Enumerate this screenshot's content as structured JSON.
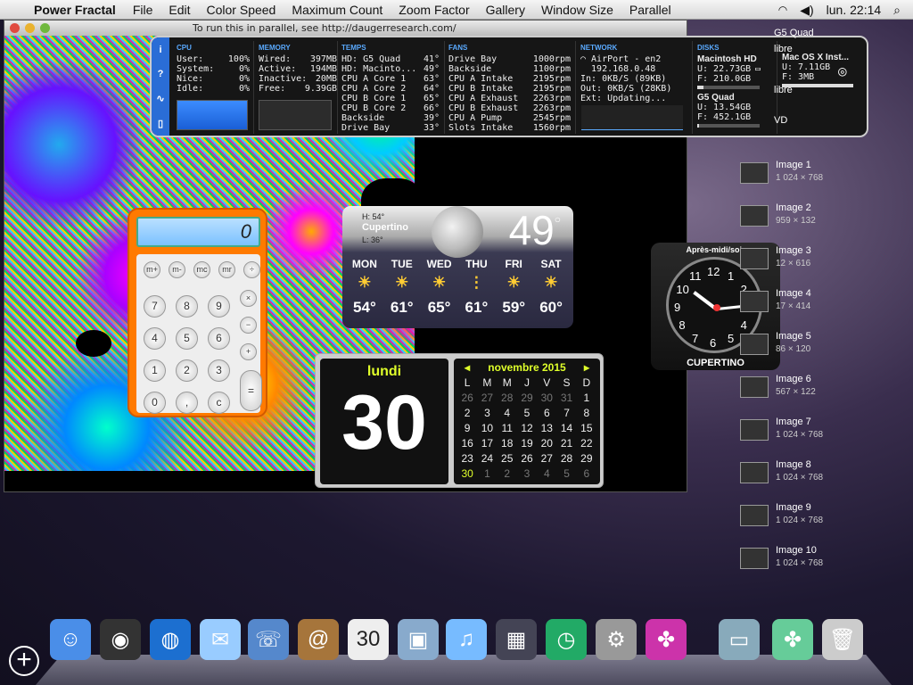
{
  "menubar": {
    "app": "Power Fractal",
    "items": [
      "File",
      "Edit",
      "Color Speed",
      "Maximum Count",
      "Zoom Factor",
      "Gallery",
      "Window Size",
      "Parallel"
    ],
    "clock": "lun. 22:14"
  },
  "window": {
    "title": "To run this in parallel, see http://daugerresearch.com/"
  },
  "istat": {
    "cpu": {
      "h": "CPU",
      "rows": [
        [
          "User:",
          "100%"
        ],
        [
          "System:",
          "0%"
        ],
        [
          "Nice:",
          "0%"
        ],
        [
          "Idle:",
          "0%"
        ]
      ]
    },
    "memory": {
      "h": "MEMORY",
      "rows": [
        [
          "Wired:",
          "397MB"
        ],
        [
          "Active:",
          "194MB"
        ],
        [
          "Inactive:",
          "20MB"
        ],
        [
          "Free:",
          "9.39GB"
        ]
      ]
    },
    "temps": {
      "h": "TEMPS",
      "rows": [
        [
          "HD: G5 Quad",
          "41°"
        ],
        [
          "HD: Macinto...",
          "49°"
        ],
        [
          "CPU A Core 1",
          "63°"
        ],
        [
          "CPU A Core 2",
          "64°"
        ],
        [
          "CPU B Core 1",
          "65°"
        ],
        [
          "CPU B Core 2",
          "66°"
        ],
        [
          "Backside",
          "39°"
        ],
        [
          "Drive Bay",
          "33°"
        ]
      ]
    },
    "fans": {
      "h": "FANS",
      "rows": [
        [
          "Drive Bay",
          "1000rpm"
        ],
        [
          "Backside",
          "1100rpm"
        ],
        [
          "CPU A Intake",
          "2195rpm"
        ],
        [
          "CPU B Intake",
          "2195rpm"
        ],
        [
          "CPU A Exhaust",
          "2263rpm"
        ],
        [
          "CPU B Exhaust",
          "2263rpm"
        ],
        [
          "CPU A Pump",
          "2545rpm"
        ],
        [
          "Slots Intake",
          "1560rpm"
        ]
      ]
    },
    "network": {
      "h": "NETWORK",
      "iface": "AirPort - en2",
      "ip": "192.168.0.48",
      "in": "In: 0KB/S (89KB)",
      "out": "Out: 0KB/S (28KB)",
      "ext": "Ext: Updating..."
    },
    "disks": {
      "h": "DISKS",
      "d1": "Macintosh HD",
      "d1u": "U: 22.73GB",
      "d1f": "F: 210.0GB",
      "d1p": 0.1,
      "d2": "G5 Quad",
      "d2u": "U: 13.54GB",
      "d2f": "F: 452.1GB",
      "d2p": 0.03,
      "d3": "Mac OS X Inst...",
      "d3u": "U: 7.11GB",
      "d3f": "F: 3MB",
      "d3p": 1.0
    }
  },
  "calculator": {
    "display": "0",
    "keys": [
      "m+",
      "m-",
      "mc",
      "mr",
      "÷",
      "7",
      "8",
      "9",
      "×",
      "4",
      "5",
      "6",
      "−",
      "1",
      "2",
      "3",
      "+",
      "0",
      ",",
      "c",
      "="
    ]
  },
  "weather": {
    "high": "H: 54°",
    "low": "L: 36°",
    "city": "Cupertino",
    "temp": "49",
    "forecast": [
      {
        "d": "MON",
        "t": "54°"
      },
      {
        "d": "TUE",
        "t": "61°"
      },
      {
        "d": "WED",
        "t": "65°"
      },
      {
        "d": "THU",
        "t": "61°"
      },
      {
        "d": "FRI",
        "t": "59°"
      },
      {
        "d": "SAT",
        "t": "60°"
      }
    ]
  },
  "clock": {
    "label": "Après-midi/soir",
    "city": "CUPERTINO",
    "hour": 10,
    "minute": 14
  },
  "calendar": {
    "day_name": "lundi",
    "day": "30",
    "month": "novembre 2015",
    "headers": [
      "L",
      "M",
      "M",
      "J",
      "V",
      "S",
      "D"
    ],
    "days": [
      "26",
      "27",
      "28",
      "29",
      "30",
      "31",
      "1",
      "2",
      "3",
      "4",
      "5",
      "6",
      "7",
      "8",
      "9",
      "10",
      "11",
      "12",
      "13",
      "14",
      "15",
      "16",
      "17",
      "18",
      "19",
      "20",
      "21",
      "22",
      "23",
      "24",
      "25",
      "26",
      "27",
      "28",
      "29",
      "30",
      "1",
      "2",
      "3",
      "4",
      "5",
      "6"
    ]
  },
  "files": [
    {
      "n": "G5 Quad"
    },
    {
      "n": "libre"
    },
    {
      "n": "libre"
    },
    {
      "n": "VD"
    },
    {
      "n": "Image 1",
      "s": "1 024 × 768"
    },
    {
      "n": "Image 2",
      "s": "959 × 132"
    },
    {
      "n": "Image 3",
      "s": "12 × 616"
    },
    {
      "n": "Image 4",
      "s": "17 × 414"
    },
    {
      "n": "Image 5",
      "s": "86 × 120"
    },
    {
      "n": "Image 6",
      "s": "567 × 122"
    },
    {
      "n": "Image 7",
      "s": "1 024 × 768"
    },
    {
      "n": "Image 8",
      "s": "1 024 × 768"
    },
    {
      "n": "Image 9",
      "s": "1 024 × 768"
    },
    {
      "n": "Image 10",
      "s": "1 024 × 768"
    }
  ],
  "dock": [
    {
      "icon": "finder-icon",
      "g": "☺",
      "c": "#4a8ee8"
    },
    {
      "icon": "dashboard-icon",
      "g": "◉",
      "c": "#333"
    },
    {
      "icon": "safari-icon",
      "g": "◍",
      "c": "#1c6fd0"
    },
    {
      "icon": "mail-icon",
      "g": "✉",
      "c": "#9cf"
    },
    {
      "icon": "ichat-icon",
      "g": "☏",
      "c": "#58c"
    },
    {
      "icon": "address-book-icon",
      "g": "@",
      "c": "#a6753b"
    },
    {
      "icon": "ical-icon",
      "g": "30",
      "c": "#eee"
    },
    {
      "icon": "iphoto-icon",
      "g": "▣",
      "c": "#8ac"
    },
    {
      "icon": "itunes-icon",
      "g": "♫",
      "c": "#7bf"
    },
    {
      "icon": "spaces-icon",
      "g": "▦",
      "c": "#445"
    },
    {
      "icon": "time-machine-icon",
      "g": "◷",
      "c": "#2a6"
    },
    {
      "icon": "system-preferences-icon",
      "g": "⚙",
      "c": "#999"
    },
    {
      "icon": "power-fractal-icon",
      "g": "✤",
      "c": "#c3a"
    },
    {
      "icon": "documents-folder-icon",
      "g": "▭",
      "c": "#8ab"
    },
    {
      "icon": "fractal-doc-icon",
      "g": "✤",
      "c": "#6c9"
    },
    {
      "icon": "trash-icon",
      "g": "🗑",
      "c": "#ccc"
    }
  ],
  "colors": {
    "accent": "#2a6dd6",
    "calc": "#ff7a00",
    "cal_accent": "#dfff2a"
  }
}
